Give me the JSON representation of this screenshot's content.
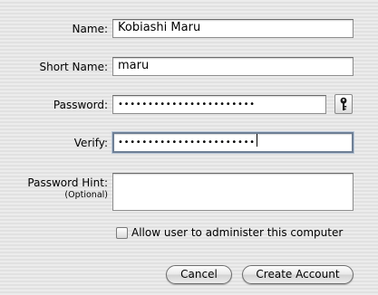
{
  "form": {
    "name": {
      "label": "Name:",
      "value": "Kobiashi Maru"
    },
    "short_name": {
      "label": "Short Name:",
      "value": "maru"
    },
    "password": {
      "label": "Password:",
      "masked_value": "•••••••••••••••••••••••",
      "key_icon": "key-icon"
    },
    "verify": {
      "label": "Verify:",
      "masked_value": "•••••••••••••••••••••••"
    },
    "password_hint": {
      "label": "Password Hint:",
      "sublabel": "(Optional)",
      "value": ""
    },
    "admin_checkbox": {
      "label": "Allow user to administer this computer",
      "checked": false
    }
  },
  "buttons": {
    "cancel": "Cancel",
    "create_account": "Create Account"
  },
  "colors": {
    "focus_ring": "#6e7f95",
    "window_bg": "#e6e6e6"
  }
}
